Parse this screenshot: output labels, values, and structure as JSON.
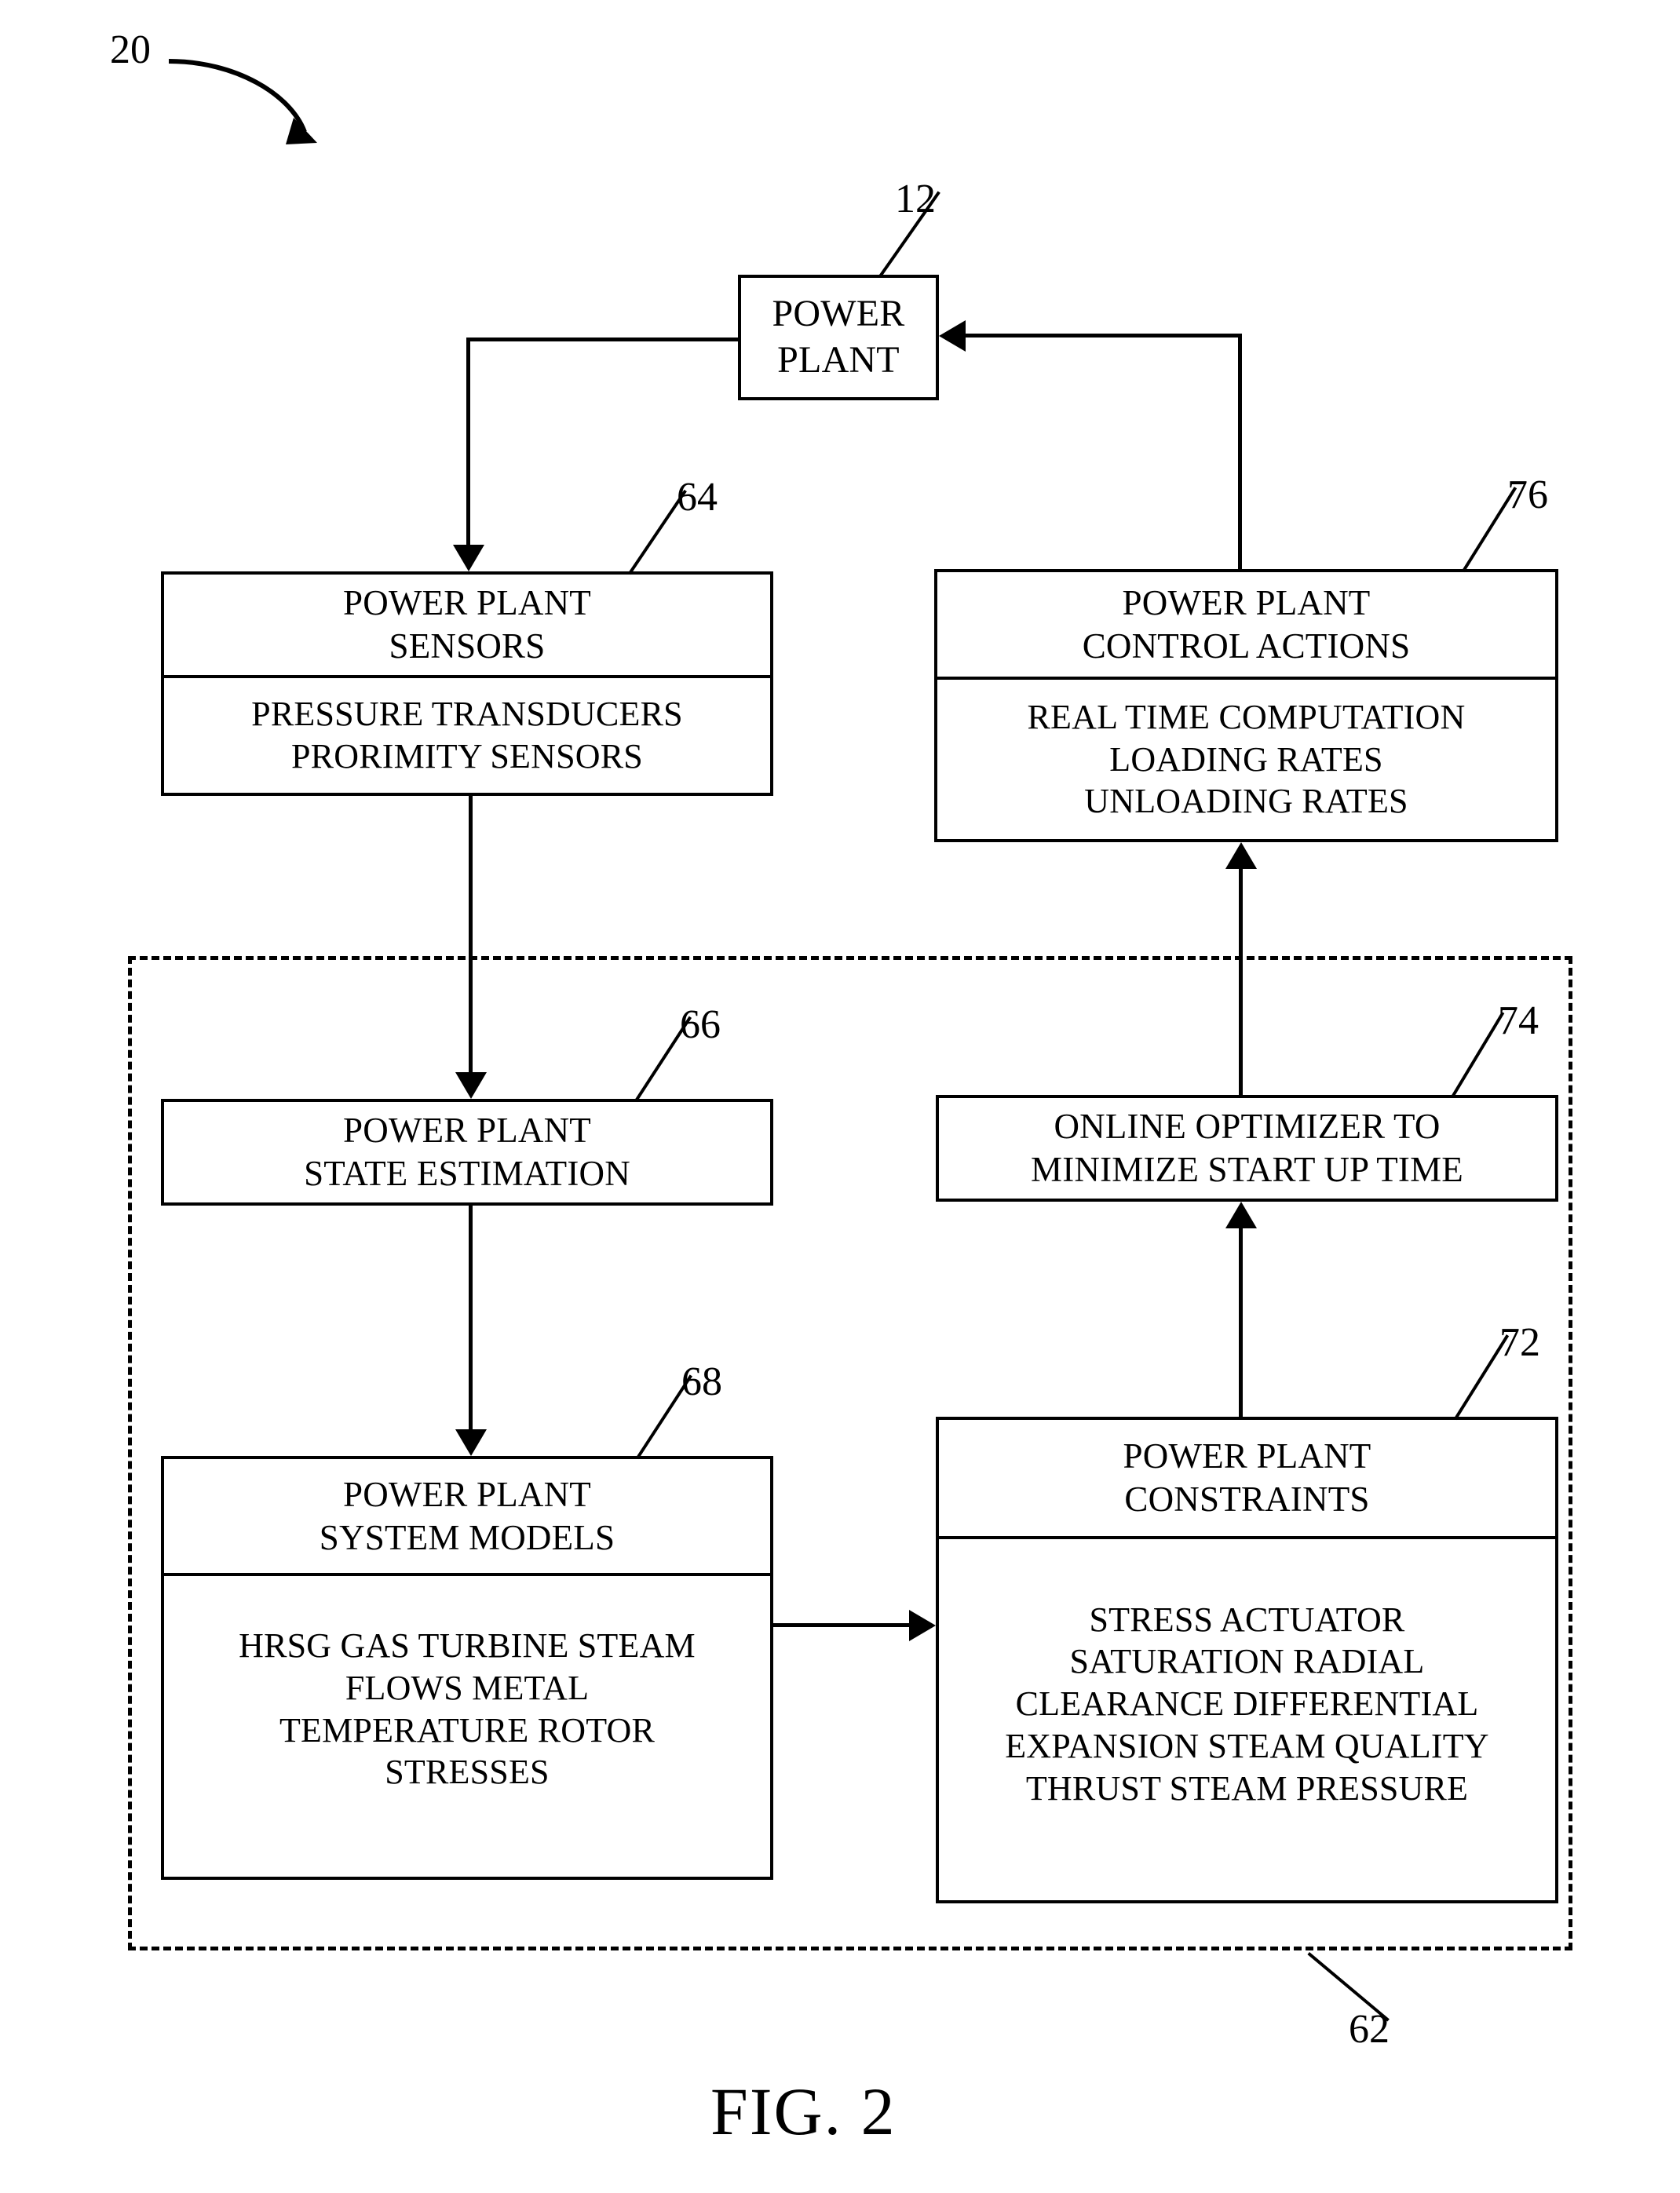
{
  "figure": {
    "caption": "FIG. 2",
    "system_numeral": "20",
    "enclosure_numeral": "62"
  },
  "blocks": {
    "power_plant": {
      "numeral": "12",
      "title_lines": [
        "POWER",
        "PLANT"
      ]
    },
    "sensors": {
      "numeral": "64",
      "title_lines": [
        "POWER PLANT",
        "SENSORS"
      ],
      "detail_lines": [
        "PRESSURE TRANSDUCERS",
        "PRORIMITY SENSORS"
      ]
    },
    "control_actions": {
      "numeral": "76",
      "title_lines": [
        "POWER PLANT",
        "CONTROL ACTIONS"
      ],
      "detail_lines": [
        "REAL TIME COMPUTATION",
        "LOADING RATES",
        "UNLOADING RATES"
      ]
    },
    "state_estimation": {
      "numeral": "66",
      "title_lines": [
        "POWER PLANT",
        "STATE ESTIMATION"
      ]
    },
    "optimizer": {
      "numeral": "74",
      "title_lines": [
        "ONLINE OPTIMIZER TO",
        "MINIMIZE START UP TIME"
      ]
    },
    "system_models": {
      "numeral": "68",
      "title_lines": [
        "POWER PLANT",
        "SYSTEM MODELS"
      ],
      "detail_lines": [
        "HRSG GAS TURBINE STEAM",
        "FLOWS METAL",
        "TEMPERATURE ROTOR",
        "STRESSES"
      ]
    },
    "constraints": {
      "numeral": "72",
      "title_lines": [
        "POWER PLANT",
        "CONSTRAINTS"
      ],
      "detail_lines": [
        "STRESS ACTUATOR",
        "SATURATION RADIAL",
        "CLEARANCE DIFFERENTIAL",
        "EXPANSION STEAM QUALITY",
        "THRUST STEAM PRESSURE"
      ]
    }
  },
  "colors": {
    "ink": "#000000",
    "paper": "#ffffff"
  }
}
